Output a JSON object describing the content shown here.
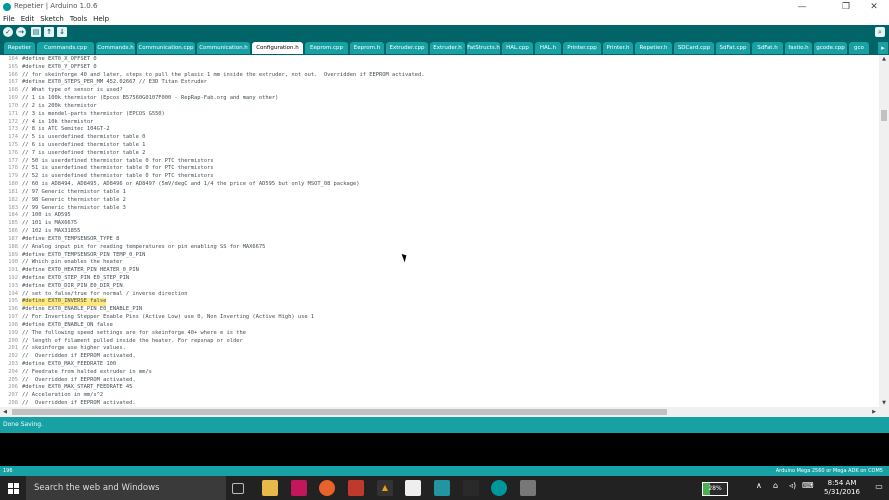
{
  "window": {
    "title": "Repetier | Arduino 1.0.6",
    "minimize": "—",
    "restore": "❐",
    "close": "✕"
  },
  "menu": [
    "File",
    "Edit",
    "Sketch",
    "Tools",
    "Help"
  ],
  "toolbar": {
    "verify": "✓",
    "upload": "→",
    "new": "▤",
    "open": "↑",
    "save": "↓",
    "serial_monitor": "⌕"
  },
  "tabs": [
    "Repetier",
    "Commands.cpp",
    "Commands.h",
    "Communication.cpp",
    "Communication.h",
    "Configuration.h",
    "Eeprom.cpp",
    "Eeprom.h",
    "Extruder.cpp",
    "Extruder.h",
    "FatStructs.h",
    "HAL.cpp",
    "HAL.h",
    "Printer.cpp",
    "Printer.h",
    "Repetier.h",
    "SDCard.cpp",
    "SdFat.cpp",
    "SdFat.h",
    "fastio.h",
    "gcode.cpp",
    "gco"
  ],
  "active_tab": "Configuration.h",
  "tab_menu": "▸",
  "code_lines": [
    {
      "n": "164",
      "t": "#define EXT0_X_OFFSET 0"
    },
    {
      "n": "165",
      "t": "#define EXT0_Y_OFFSET 0"
    },
    {
      "n": "166",
      "t": "// for skeinforge 40 and later, steps to pull the plasic 1 mm inside the extruder, not out.  Overridden if EEPROM activated."
    },
    {
      "n": "167",
      "t": "#define EXT0_STEPS_PER_MM 452.02667 // E3D Titan Extruder"
    },
    {
      "n": "168",
      "t": "// What type of sensor is used?"
    },
    {
      "n": "169",
      "t": "// 1 is 100k thermistor (Epcos B57560G0107F000 - RepRap-Fab.org and many other)"
    },
    {
      "n": "170",
      "t": "// 2 is 200k thermistor"
    },
    {
      "n": "171",
      "t": "// 3 is mendel-parts thermistor (EPCOS G550)"
    },
    {
      "n": "172",
      "t": "// 4 is 10k thermistor"
    },
    {
      "n": "173",
      "t": "// 8 is ATC Semitec 104GT-2"
    },
    {
      "n": "174",
      "t": "// 5 is userdefined thermistor table 0"
    },
    {
      "n": "175",
      "t": "// 6 is userdefined thermistor table 1"
    },
    {
      "n": "176",
      "t": "// 7 is userdefined thermistor table 2"
    },
    {
      "n": "177",
      "t": "// 50 is userdefined thermistor table 0 for PTC thermistors"
    },
    {
      "n": "178",
      "t": "// 51 is userdefined thermistor table 0 for PTC thermistors"
    },
    {
      "n": "179",
      "t": "// 52 is userdefined thermistor table 0 for PTC thermistors"
    },
    {
      "n": "180",
      "t": "// 60 is AD8494, AD8495, AD8496 or AD8497 (5mV/degC and 1/4 the price of AD595 but only MSOT_08 package)"
    },
    {
      "n": "181",
      "t": "// 97 Generic thermistor table 1"
    },
    {
      "n": "182",
      "t": "// 98 Generic thermistor table 2"
    },
    {
      "n": "183",
      "t": "// 99 Generic thermistor table 3"
    },
    {
      "n": "184",
      "t": "// 100 is AD595"
    },
    {
      "n": "185",
      "t": "// 101 is MAX6675"
    },
    {
      "n": "186",
      "t": "// 102 is MAX31855"
    },
    {
      "n": "187",
      "t": "#define EXT0_TEMPSENSOR_TYPE 8"
    },
    {
      "n": "188",
      "t": "// Analog input pin for reading temperatures or pin enabling SS for MAX6675"
    },
    {
      "n": "189",
      "t": "#define EXT0_TEMPSENSOR_PIN TEMP_0_PIN"
    },
    {
      "n": "190",
      "t": "// Which pin enables the heater"
    },
    {
      "n": "191",
      "t": "#define EXT0_HEATER_PIN HEATER_0_PIN"
    },
    {
      "n": "192",
      "t": "#define EXT0_STEP_PIN E0_STEP_PIN"
    },
    {
      "n": "193",
      "t": "#define EXT0_DIR_PIN E0_DIR_PIN"
    },
    {
      "n": "194",
      "t": "// set to false/true for normal / inverse direction"
    },
    {
      "n": "195",
      "t": "#define EXT0_INVERSE false",
      "hl": true
    },
    {
      "n": "196",
      "t": "#define EXT0_ENABLE_PIN E0_ENABLE_PIN"
    },
    {
      "n": "197",
      "t": "// For Inverting Stepper Enable Pins (Active Low) use 0, Non Inverting (Active High) use 1"
    },
    {
      "n": "198",
      "t": "#define EXT0_ENABLE_ON false"
    },
    {
      "n": "199",
      "t": "// The following speed settings are for skeinforge 40+ where e is the"
    },
    {
      "n": "200",
      "t": "// length of filament pulled inside the heater. For repsnap or older"
    },
    {
      "n": "201",
      "t": "// skeinforge use higher values."
    },
    {
      "n": "202",
      "t": "//  Overridden if EEPROM activated."
    },
    {
      "n": "203",
      "t": "#define EXT0_MAX_FEEDRATE 100"
    },
    {
      "n": "204",
      "t": "// Feedrate from halted extruder in mm/s"
    },
    {
      "n": "205",
      "t": "//  Overridden if EEPROM activated."
    },
    {
      "n": "206",
      "t": "#define EXT0_MAX_START_FEEDRATE 45"
    },
    {
      "n": "207",
      "t": "// Acceleration in mm/s^2"
    },
    {
      "n": "208",
      "t": "//  Overridden if EEPROM activated."
    }
  ],
  "scroll": {
    "up": "▲",
    "down": "▼",
    "left": "◀",
    "right": "▶"
  },
  "status": "Done Saving.",
  "footer": {
    "line": "196",
    "board": "Arduino Mega 2560 or Mega ADK on COM5"
  },
  "taskbar": {
    "search_placeholder": "Search the web and Windows",
    "battery_level": 0.28,
    "battery_label": "28%",
    "time": "8:54 AM",
    "date": "5/31/2016",
    "tray_chevron": "∧",
    "tray_network": "⌂",
    "tray_volume": "◃)",
    "tray_input": "⌨",
    "notifications": "▭"
  },
  "colors": {
    "arduino_dark": "#006468",
    "arduino_teal": "#17a1a5",
    "highlight": "#ffe880"
  }
}
